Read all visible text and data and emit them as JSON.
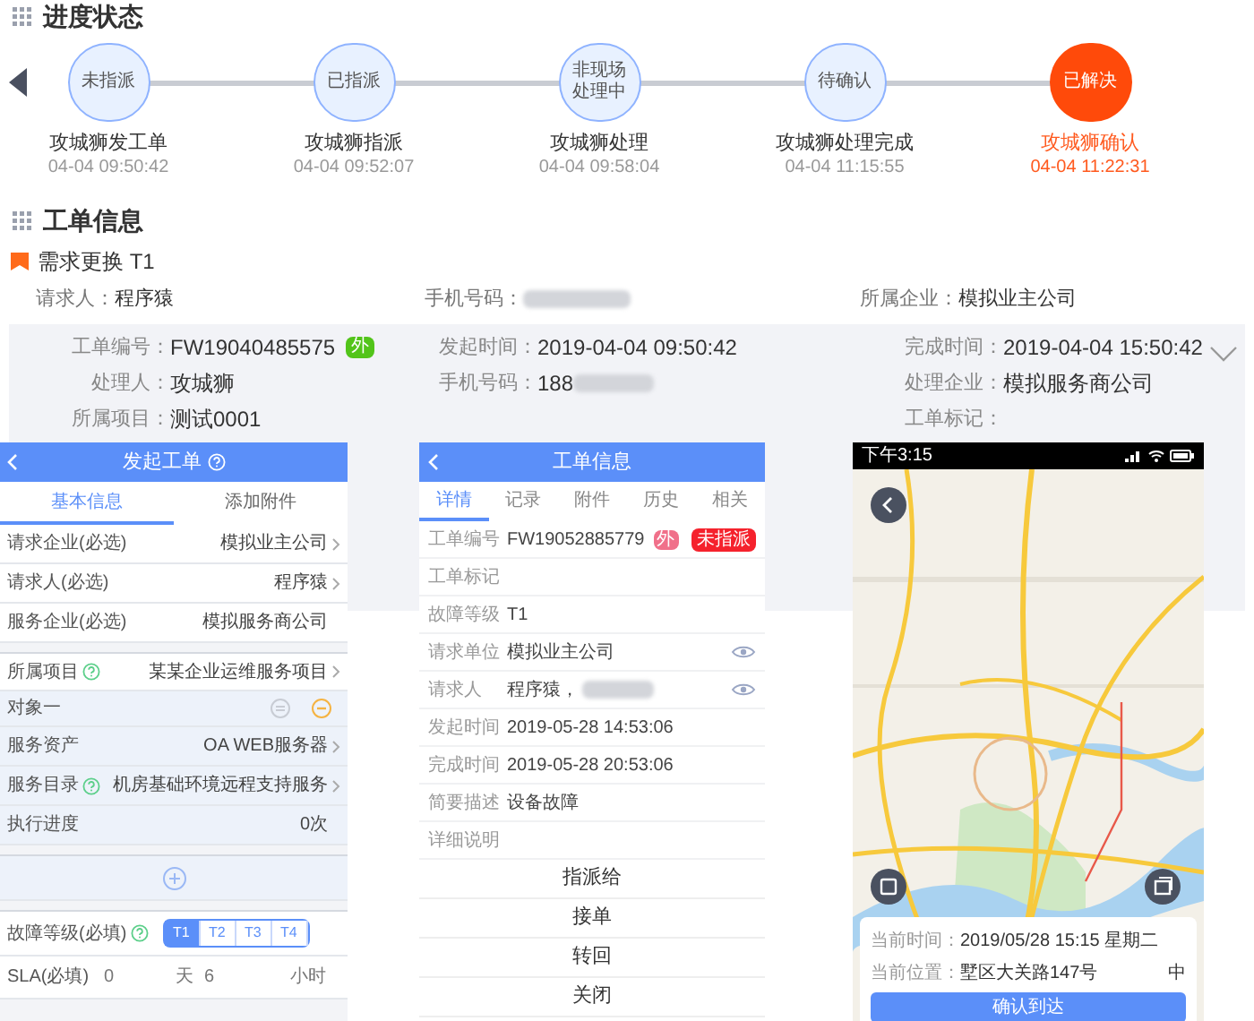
{
  "progress": {
    "title": "进度状态",
    "steps": [
      {
        "status": "未指派",
        "actor": "攻城狮发工单",
        "time": "04-04 09:50:42",
        "active": false
      },
      {
        "status": "已指派",
        "actor": "攻城狮指派",
        "time": "04-04 09:52:07",
        "active": false
      },
      {
        "status": "非现场处理中",
        "actor": "攻城狮处理",
        "time": "04-04 09:58:04",
        "active": false
      },
      {
        "status": "待确认",
        "actor": "攻城狮处理完成",
        "time": "04-04 11:15:55",
        "active": false
      },
      {
        "status": "已解决",
        "actor": "攻城狮确认",
        "time": "04-04 11:22:31",
        "active": true
      }
    ]
  },
  "order_info": {
    "title": "工单信息",
    "request_title": "需求更换 T1",
    "summary": [
      {
        "label": "请求人：",
        "value": "程序猿",
        "redacted": false
      },
      {
        "label": "手机号码：",
        "redacted": true
      },
      {
        "label": "所属企业：",
        "value": "模拟业主公司",
        "redacted": false
      }
    ],
    "columns": [
      [
        {
          "label": "工单编号：",
          "value": "FW19040485575",
          "badge": "外"
        },
        {
          "label": "处理人：",
          "value": "攻城狮"
        },
        {
          "label": "所属项目：",
          "value": "测试0001"
        }
      ],
      [
        {
          "label": "发起时间：",
          "value": "2019-04-04 09:50:42"
        },
        {
          "label": "手机号码：",
          "value": "188",
          "redacted": true
        }
      ],
      [
        {
          "label": "完成时间：",
          "value": "2019-04-04 15:50:42"
        },
        {
          "label": "处理企业：",
          "value": "模拟服务商公司"
        },
        {
          "label": "工单标记："
        }
      ]
    ]
  },
  "create_form": {
    "title": "发起工单",
    "tabs": [
      {
        "label": "基本信息",
        "selected": true
      },
      {
        "label": "添加附件",
        "selected": false
      }
    ],
    "rows": [
      {
        "kind": "field",
        "label": "请求企业(必选)",
        "value": "模拟业主公司",
        "help": false,
        "chevron": true,
        "section_start": false,
        "shaded": false
      },
      {
        "kind": "field",
        "label": "请求人(必选)",
        "value": "程序猿",
        "help": false,
        "chevron": true,
        "section_start": false,
        "shaded": false
      },
      {
        "kind": "field",
        "label": "服务企业(必选)",
        "value": "模拟服务商公司",
        "help": false,
        "chevron": false,
        "section_start": false,
        "shaded": false
      },
      {
        "kind": "field",
        "label": "所属项目",
        "value": "某某企业运维服务项目",
        "help": true,
        "chevron": true,
        "section_start": true,
        "shaded": false
      },
      {
        "kind": "object",
        "label": "对象一",
        "section_start": false,
        "shaded": true
      },
      {
        "kind": "field",
        "label": "服务资产",
        "value": "OA WEB服务器",
        "help": false,
        "chevron": true,
        "section_start": false,
        "shaded": true
      },
      {
        "kind": "field",
        "label": "服务目录",
        "value": "机房基础环境远程支持服务",
        "help": true,
        "chevron": true,
        "section_start": false,
        "shaded": true
      },
      {
        "kind": "field",
        "label": "执行进度",
        "value": "0次",
        "help": false,
        "chevron": false,
        "section_start": false,
        "shaded": true
      },
      {
        "kind": "add",
        "section_start": true,
        "shaded": true
      },
      {
        "kind": "level",
        "label": "故障等级(必填)",
        "help": true,
        "section_start": true,
        "shaded": false,
        "options": [
          {
            "label": "T1",
            "selected": true
          },
          {
            "label": "T2",
            "selected": false
          },
          {
            "label": "T3",
            "selected": false
          },
          {
            "label": "T4",
            "selected": false
          }
        ]
      },
      {
        "kind": "sla",
        "label": "SLA(必填)",
        "days": "0",
        "day_unit": "天",
        "hours": "6",
        "hour_unit": "小时",
        "section_start": false,
        "shaded": false
      }
    ]
  },
  "order_detail": {
    "title": "工单信息",
    "tabs": [
      {
        "label": "详情",
        "selected": true
      },
      {
        "label": "记录",
        "selected": false
      },
      {
        "label": "附件",
        "selected": false
      },
      {
        "label": "历史",
        "selected": false
      },
      {
        "label": "相关",
        "selected": false
      }
    ],
    "rows": [
      {
        "label": "工单编号",
        "value": "FW19052885779",
        "badge": "外",
        "tag": "未指派",
        "eye": false,
        "redacted": false
      },
      {
        "label": "工单标记",
        "eye": false,
        "redacted": false
      },
      {
        "label": "故障等级",
        "value": "T1",
        "eye": false,
        "redacted": false
      },
      {
        "label": "请求单位",
        "value": "模拟业主公司",
        "eye": true,
        "redacted": false
      },
      {
        "label": "请求人",
        "value": "程序猿，",
        "eye": true,
        "redacted": true
      },
      {
        "label": "发起时间",
        "value": "2019-05-28 14:53:06",
        "eye": false,
        "redacted": false
      },
      {
        "label": "完成时间",
        "value": "2019-05-28 20:53:06",
        "eye": false,
        "redacted": false
      },
      {
        "label": "简要描述",
        "value": "设备故障",
        "eye": false,
        "redacted": false
      },
      {
        "label": "详细说明",
        "eye": false,
        "redacted": false
      }
    ],
    "actions": [
      "指派给",
      "接单",
      "转回",
      "关闭"
    ]
  },
  "map_screen": {
    "status_time": "下午3:15",
    "time_label": "当前时间：",
    "time_value": "2019/05/28 15:15 星期二",
    "location_label": "当前位置：",
    "location_value": "墅区大关路147号",
    "location_extra": "中",
    "confirm_button": "确认到达"
  }
}
